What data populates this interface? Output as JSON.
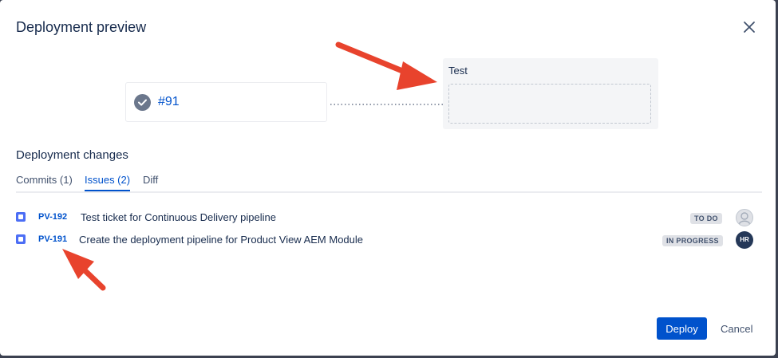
{
  "dialog": {
    "title": "Deployment preview",
    "close_icon": "close-icon"
  },
  "pipeline": {
    "build": {
      "status_icon": "check-circle-icon",
      "label": "#91"
    },
    "environment": {
      "name": "Test"
    }
  },
  "changes": {
    "section_title": "Deployment changes",
    "tabs": [
      {
        "label": "Commits (1)",
        "active": false
      },
      {
        "label": "Issues (2)",
        "active": true
      },
      {
        "label": "Diff",
        "active": false
      }
    ],
    "issues": [
      {
        "type_icon": "story-icon",
        "key": "PV-192",
        "summary": "Test ticket for Continuous Delivery pipeline",
        "status": "TO DO",
        "assignee": {
          "type": "empty",
          "initials": ""
        }
      },
      {
        "type_icon": "story-icon",
        "key": "PV-191",
        "summary": "Create the deployment pipeline for Product View AEM Module",
        "status": "IN PROGRESS",
        "assignee": {
          "type": "initials",
          "initials": "HR"
        }
      }
    ]
  },
  "footer": {
    "deploy_label": "Deploy",
    "cancel_label": "Cancel"
  },
  "colors": {
    "primary": "#0052cc",
    "annotation": "#e8432d"
  }
}
